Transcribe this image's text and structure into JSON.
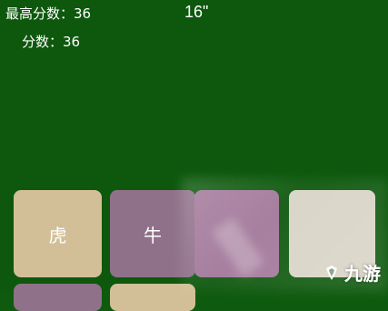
{
  "hud": {
    "best_score": "最高分数：36",
    "score": "分数：36",
    "timer": "16\""
  },
  "tiles": {
    "row1": [
      "虎",
      "牛",
      "",
      ""
    ],
    "row2": [
      "",
      ""
    ]
  },
  "watermark": {
    "text": "九游"
  },
  "colors": {
    "background": "#0d580d",
    "tile_tan": "#d2bf97",
    "tile_mauve": "#90718a",
    "tile_light": "#d8d4c6",
    "text": "#ffffff"
  }
}
